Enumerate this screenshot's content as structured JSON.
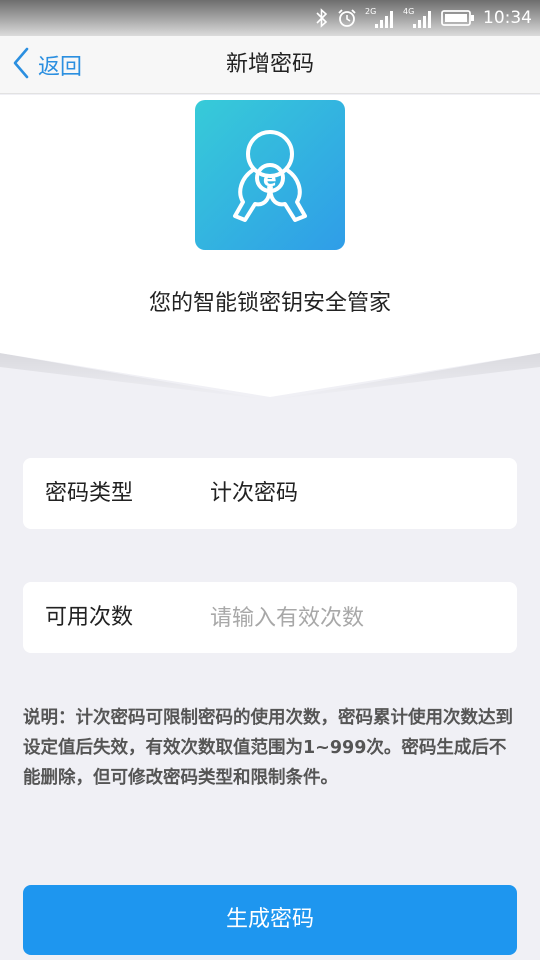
{
  "status_bar": {
    "time": "10:34",
    "network_1": "2G",
    "network_2": "4G"
  },
  "nav": {
    "back_label": "返回",
    "title": "新增密码"
  },
  "hero": {
    "slogan": "您的智能锁密钥安全管家"
  },
  "form": {
    "password_type": {
      "label": "密码类型",
      "value": "计次密码"
    },
    "use_count": {
      "label": "可用次数",
      "value": "",
      "placeholder": "请输入有效次数"
    }
  },
  "note": "说明：计次密码可限制密码的使用次数，密码累计使用次数达到设定值后失效，有效次数取值范围为1~999次。密码生成后不能删除，但可修改密码类型和限制条件。",
  "submit_label": "生成密码",
  "colors": {
    "accent": "#1e96ef",
    "link": "#2b8fe0",
    "background": "#f0f0f5",
    "logo_gradient_start": "#37cbd8",
    "logo_gradient_end": "#2f9de8"
  }
}
